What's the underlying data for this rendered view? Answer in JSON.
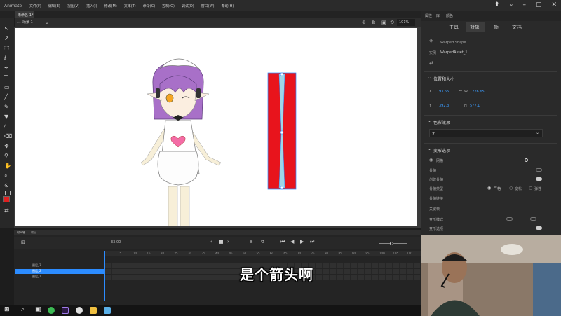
{
  "app": {
    "name": "Animate"
  },
  "menu": [
    "文件(F)",
    "编辑(E)",
    "视图(V)",
    "插入(I)",
    "修改(M)",
    "文本(T)",
    "命令(C)",
    "控制(O)",
    "调试(D)",
    "窗口(W)",
    "帮助(H)"
  ],
  "document": {
    "tab": "未命名-1*",
    "scene": "场景 1",
    "zoom": "101%"
  },
  "properties": {
    "top_tabs": [
      "属性",
      "库",
      "颜色"
    ],
    "tabs": [
      "工具",
      "对象",
      "帧",
      "文档"
    ],
    "active_tab": "对象",
    "object_type": "Warped Shape",
    "instance_label": "实例",
    "instance_name": "WarpedAsset_1",
    "section_position": "位置和大小",
    "x_label": "X",
    "x_value": "93.65",
    "y_label": "Y",
    "y_value": "392.3",
    "w_label": "W",
    "w_value": "1226.65",
    "h_label": "H",
    "h_value": "577.1",
    "section_color": "色彩效果",
    "color_effect_value": "无",
    "section_warp": "变形选项",
    "warp_rows": [
      "网格",
      "骨骼",
      "创建骨骼",
      "骨骼类型",
      "骨骼链接",
      "关键帧",
      "变形模式",
      "变形选项"
    ],
    "bone_type_options": [
      "严格",
      "宽松",
      "弹性"
    ]
  },
  "timeline": {
    "panel_tabs": [
      "时间轴",
      "输出"
    ],
    "frame_readout": "33.00",
    "layers": [
      "图层_3",
      "图层_2",
      "图层_1"
    ],
    "ruler": [
      "1",
      "5",
      "10",
      "15",
      "20",
      "25",
      "30",
      "35",
      "40",
      "45",
      "50",
      "55",
      "60",
      "65",
      "70",
      "75",
      "80",
      "85",
      "90",
      "95",
      "100",
      "105",
      "110"
    ]
  },
  "subtitle": "是个箭头啊",
  "colors": {
    "accent": "#2c8cff",
    "stage": "#ffffff",
    "shape_fill": "#e8141c",
    "fill_swatch": "#e02020"
  }
}
